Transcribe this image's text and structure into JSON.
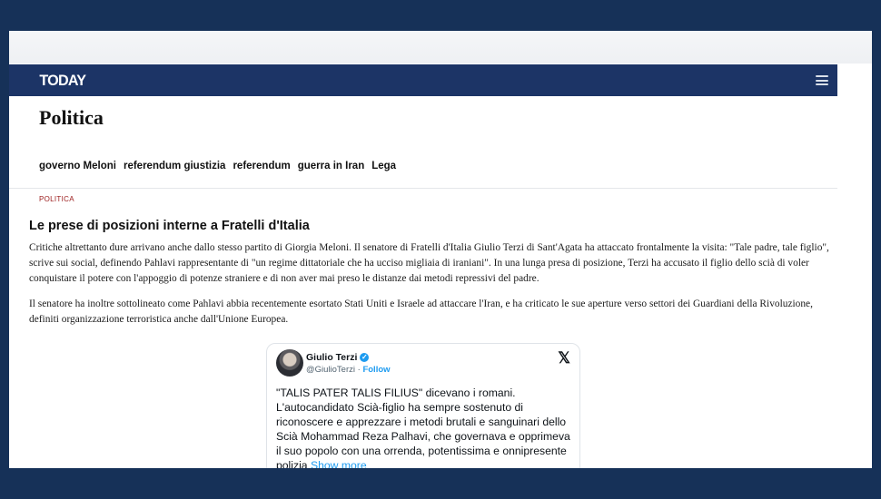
{
  "header": {
    "logo": "TODAY",
    "menu_icon": "hamburger-menu-icon"
  },
  "section": {
    "title": "Politica",
    "tags": [
      "governo Meloni",
      "referendum giustizia",
      "referendum",
      "guerra in Iran",
      "Lega"
    ]
  },
  "article": {
    "category": "POLITICA",
    "headline": "Le prese di posizioni interne a Fratelli d'Italia",
    "paragraph1": "Critiche altrettanto dure arrivano anche dallo stesso partito di Giorgia Meloni. Il senatore di Fratelli d'Italia Giulio Terzi di Sant'Agata ha attaccato frontalmente la visita: \"Tale padre, tale figlio\", scrive sui social, definendo Pahlavi rappresentante di \"un regime dittatoriale che ha ucciso migliaia di iraniani\". In una lunga presa di posizione, Terzi ha accusato il figlio dello scià di voler conquistare il potere con l'appoggio di potenze straniere e di non aver mai preso le distanze dai metodi repressivi del padre.",
    "paragraph2": "Il senatore ha inoltre sottolineato come Pahlavi abbia recentemente esortato Stati Uniti e Israele ad attaccare l'Iran, e ha criticato le sue aperture verso settori dei Guardiani della Rivoluzione, definiti organizzazione terroristica anche dall'Unione Europea."
  },
  "tweet": {
    "name": "Giulio Terzi",
    "verified_icon": "verified-badge-icon",
    "handle": "@GiulioTerzi",
    "separator": " · ",
    "follow": "Follow",
    "platform_icon": "x-logo-icon",
    "platform_glyph": "𝕏",
    "text": "\"TALIS PATER TALIS FILIUS\" dicevano i romani. L'autocandidato Scià-figlio ha sempre sostenuto di riconoscere e apprezzare i metodi brutali e sanguinari dello Scià Mohammad Reza Palhavi, che governava e opprimeva il suo popolo con una orrenda, potentissima e onnipresente polizia",
    "show_more": "Show more"
  },
  "colors": {
    "background": "#163158",
    "header": "#1c3466",
    "category": "#9b1b1b",
    "link": "#1d9bf0"
  }
}
